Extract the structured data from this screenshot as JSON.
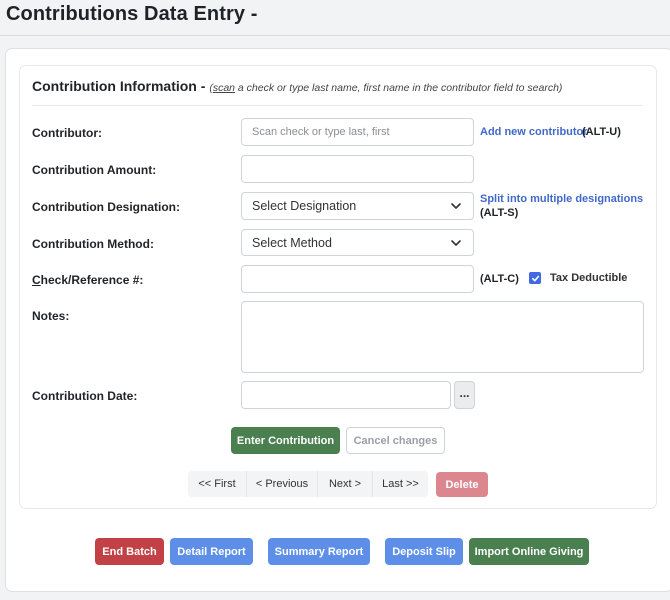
{
  "page": {
    "title": "Contributions Data Entry -"
  },
  "section": {
    "title": "Contribution Information -",
    "hint_open": "(",
    "hint_scan": "scan",
    "hint_rest": " a check or type last name, first name in the contributor field to search)"
  },
  "fields": {
    "contributor": {
      "label": "Contributor:",
      "placeholder": "Scan check or type last, first",
      "value": ""
    },
    "amount": {
      "label": "Contribution Amount:",
      "value": ""
    },
    "designation": {
      "label": "Contribution Designation:",
      "selected": "Select Designation"
    },
    "method": {
      "label": "Contribution Method:",
      "selected": "Select Method"
    },
    "check_ref": {
      "label_underlined": "C",
      "label_rest": "heck/Reference #:",
      "value": ""
    },
    "notes": {
      "label": "Notes:",
      "value": ""
    },
    "date": {
      "label": "Contribution Date:",
      "value": ""
    }
  },
  "links": {
    "add_contributor": "Add new contributor",
    "add_contributor_shortcut": "(ALT-U)",
    "split_designations": "Split into multiple designations",
    "split_shortcut": "(ALT-S)",
    "check_shortcut": "(ALT-C)"
  },
  "tax_deductible": {
    "label": "Tax Deductible",
    "checked": true
  },
  "date_picker_label": "...",
  "actions": {
    "enter_contribution": "Enter Contribution",
    "cancel_changes": "Cancel changes"
  },
  "pager": {
    "first": "<< First",
    "previous": "< Previous",
    "next": "Next >",
    "last": "Last >>",
    "delete": "Delete"
  },
  "footer": {
    "end_batch": "End Batch",
    "detail_report": "Detail Report",
    "summary_report": "Summary Report",
    "deposit_slip": "Deposit Slip",
    "import_online_giving": "Import Online Giving"
  },
  "colors": {
    "green": "#4a7f4f",
    "red": "#c24147",
    "blue": "#5d8fe9",
    "delete_pink": "#dc8790",
    "link_blue": "#4169c9",
    "checkbox_blue": "#4169e1"
  },
  "icons": {
    "select_chevron": "chevron-down-icon",
    "checkbox_mark": "checkmark-icon"
  }
}
